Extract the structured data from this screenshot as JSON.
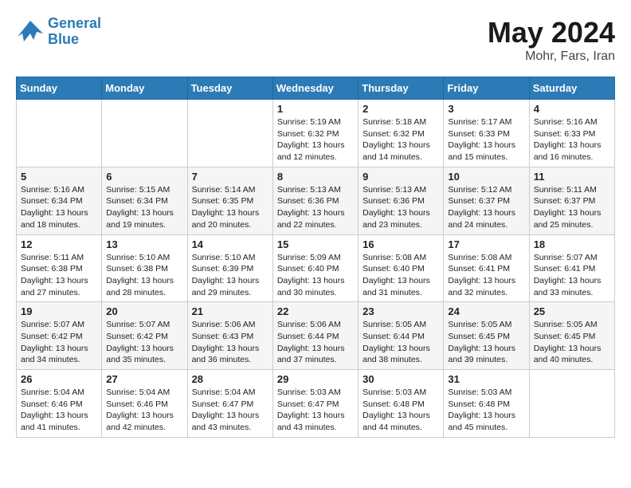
{
  "header": {
    "logo_line1": "General",
    "logo_line2": "Blue",
    "month": "May 2024",
    "location": "Mohr, Fars, Iran"
  },
  "weekdays": [
    "Sunday",
    "Monday",
    "Tuesday",
    "Wednesday",
    "Thursday",
    "Friday",
    "Saturday"
  ],
  "rows": [
    [
      {
        "day": "",
        "sunrise": "",
        "sunset": "",
        "daylight": ""
      },
      {
        "day": "",
        "sunrise": "",
        "sunset": "",
        "daylight": ""
      },
      {
        "day": "",
        "sunrise": "",
        "sunset": "",
        "daylight": ""
      },
      {
        "day": "1",
        "sunrise": "Sunrise: 5:19 AM",
        "sunset": "Sunset: 6:32 PM",
        "daylight": "Daylight: 13 hours and 12 minutes."
      },
      {
        "day": "2",
        "sunrise": "Sunrise: 5:18 AM",
        "sunset": "Sunset: 6:32 PM",
        "daylight": "Daylight: 13 hours and 14 minutes."
      },
      {
        "day": "3",
        "sunrise": "Sunrise: 5:17 AM",
        "sunset": "Sunset: 6:33 PM",
        "daylight": "Daylight: 13 hours and 15 minutes."
      },
      {
        "day": "4",
        "sunrise": "Sunrise: 5:16 AM",
        "sunset": "Sunset: 6:33 PM",
        "daylight": "Daylight: 13 hours and 16 minutes."
      }
    ],
    [
      {
        "day": "5",
        "sunrise": "Sunrise: 5:16 AM",
        "sunset": "Sunset: 6:34 PM",
        "daylight": "Daylight: 13 hours and 18 minutes."
      },
      {
        "day": "6",
        "sunrise": "Sunrise: 5:15 AM",
        "sunset": "Sunset: 6:34 PM",
        "daylight": "Daylight: 13 hours and 19 minutes."
      },
      {
        "day": "7",
        "sunrise": "Sunrise: 5:14 AM",
        "sunset": "Sunset: 6:35 PM",
        "daylight": "Daylight: 13 hours and 20 minutes."
      },
      {
        "day": "8",
        "sunrise": "Sunrise: 5:13 AM",
        "sunset": "Sunset: 6:36 PM",
        "daylight": "Daylight: 13 hours and 22 minutes."
      },
      {
        "day": "9",
        "sunrise": "Sunrise: 5:13 AM",
        "sunset": "Sunset: 6:36 PM",
        "daylight": "Daylight: 13 hours and 23 minutes."
      },
      {
        "day": "10",
        "sunrise": "Sunrise: 5:12 AM",
        "sunset": "Sunset: 6:37 PM",
        "daylight": "Daylight: 13 hours and 24 minutes."
      },
      {
        "day": "11",
        "sunrise": "Sunrise: 5:11 AM",
        "sunset": "Sunset: 6:37 PM",
        "daylight": "Daylight: 13 hours and 25 minutes."
      }
    ],
    [
      {
        "day": "12",
        "sunrise": "Sunrise: 5:11 AM",
        "sunset": "Sunset: 6:38 PM",
        "daylight": "Daylight: 13 hours and 27 minutes."
      },
      {
        "day": "13",
        "sunrise": "Sunrise: 5:10 AM",
        "sunset": "Sunset: 6:38 PM",
        "daylight": "Daylight: 13 hours and 28 minutes."
      },
      {
        "day": "14",
        "sunrise": "Sunrise: 5:10 AM",
        "sunset": "Sunset: 6:39 PM",
        "daylight": "Daylight: 13 hours and 29 minutes."
      },
      {
        "day": "15",
        "sunrise": "Sunrise: 5:09 AM",
        "sunset": "Sunset: 6:40 PM",
        "daylight": "Daylight: 13 hours and 30 minutes."
      },
      {
        "day": "16",
        "sunrise": "Sunrise: 5:08 AM",
        "sunset": "Sunset: 6:40 PM",
        "daylight": "Daylight: 13 hours and 31 minutes."
      },
      {
        "day": "17",
        "sunrise": "Sunrise: 5:08 AM",
        "sunset": "Sunset: 6:41 PM",
        "daylight": "Daylight: 13 hours and 32 minutes."
      },
      {
        "day": "18",
        "sunrise": "Sunrise: 5:07 AM",
        "sunset": "Sunset: 6:41 PM",
        "daylight": "Daylight: 13 hours and 33 minutes."
      }
    ],
    [
      {
        "day": "19",
        "sunrise": "Sunrise: 5:07 AM",
        "sunset": "Sunset: 6:42 PM",
        "daylight": "Daylight: 13 hours and 34 minutes."
      },
      {
        "day": "20",
        "sunrise": "Sunrise: 5:07 AM",
        "sunset": "Sunset: 6:42 PM",
        "daylight": "Daylight: 13 hours and 35 minutes."
      },
      {
        "day": "21",
        "sunrise": "Sunrise: 5:06 AM",
        "sunset": "Sunset: 6:43 PM",
        "daylight": "Daylight: 13 hours and 36 minutes."
      },
      {
        "day": "22",
        "sunrise": "Sunrise: 5:06 AM",
        "sunset": "Sunset: 6:44 PM",
        "daylight": "Daylight: 13 hours and 37 minutes."
      },
      {
        "day": "23",
        "sunrise": "Sunrise: 5:05 AM",
        "sunset": "Sunset: 6:44 PM",
        "daylight": "Daylight: 13 hours and 38 minutes."
      },
      {
        "day": "24",
        "sunrise": "Sunrise: 5:05 AM",
        "sunset": "Sunset: 6:45 PM",
        "daylight": "Daylight: 13 hours and 39 minutes."
      },
      {
        "day": "25",
        "sunrise": "Sunrise: 5:05 AM",
        "sunset": "Sunset: 6:45 PM",
        "daylight": "Daylight: 13 hours and 40 minutes."
      }
    ],
    [
      {
        "day": "26",
        "sunrise": "Sunrise: 5:04 AM",
        "sunset": "Sunset: 6:46 PM",
        "daylight": "Daylight: 13 hours and 41 minutes."
      },
      {
        "day": "27",
        "sunrise": "Sunrise: 5:04 AM",
        "sunset": "Sunset: 6:46 PM",
        "daylight": "Daylight: 13 hours and 42 minutes."
      },
      {
        "day": "28",
        "sunrise": "Sunrise: 5:04 AM",
        "sunset": "Sunset: 6:47 PM",
        "daylight": "Daylight: 13 hours and 43 minutes."
      },
      {
        "day": "29",
        "sunrise": "Sunrise: 5:03 AM",
        "sunset": "Sunset: 6:47 PM",
        "daylight": "Daylight: 13 hours and 43 minutes."
      },
      {
        "day": "30",
        "sunrise": "Sunrise: 5:03 AM",
        "sunset": "Sunset: 6:48 PM",
        "daylight": "Daylight: 13 hours and 44 minutes."
      },
      {
        "day": "31",
        "sunrise": "Sunrise: 5:03 AM",
        "sunset": "Sunset: 6:48 PM",
        "daylight": "Daylight: 13 hours and 45 minutes."
      },
      {
        "day": "",
        "sunrise": "",
        "sunset": "",
        "daylight": ""
      }
    ]
  ]
}
